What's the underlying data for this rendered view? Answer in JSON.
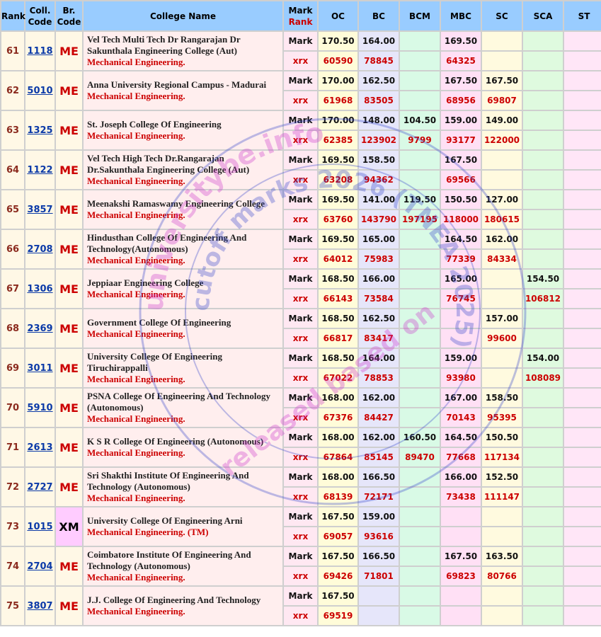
{
  "headers": {
    "rank": "Rank",
    "code_1": "Coll.",
    "code_2": "Code",
    "br_1": "Br.",
    "br_2": "Code",
    "college": "College Name",
    "mark_rank_1": "Mark",
    "mark_rank_2": "Rank",
    "oc": "OC",
    "bc": "BC",
    "bcm": "BCM",
    "mbc": "MBC",
    "sc": "SC",
    "sca": "SCA",
    "st": "ST"
  },
  "labels": {
    "mark": "Mark",
    "rank": "xrx"
  },
  "watermark": {
    "line1": "cutoff marks 2026 (TNEA 2025)",
    "line2": "universitybe.info",
    "line3": "released based on"
  },
  "colleges": [
    {
      "rank": "61",
      "code": "1118",
      "branch": "ME",
      "name": "Vel Tech Multi Tech Dr Rangarajan Dr Sakunthala Engineering College (Aut)",
      "course": "Mechanical Engineering.",
      "mark": {
        "oc": "170.50",
        "bc": "164.00",
        "bcm": "",
        "mbc": "169.50",
        "sc": "",
        "sca": "",
        "st": ""
      },
      "rank_vals": {
        "oc": "60590",
        "bc": "78845",
        "bcm": "",
        "mbc": "64325",
        "sc": "",
        "sca": "",
        "st": ""
      }
    },
    {
      "rank": "62",
      "code": "5010",
      "branch": "ME",
      "name": "Anna University Regional Campus - Madurai",
      "course": "Mechanical Engineering.",
      "mark": {
        "oc": "170.00",
        "bc": "162.50",
        "bcm": "",
        "mbc": "167.50",
        "sc": "167.50",
        "sca": "",
        "st": ""
      },
      "rank_vals": {
        "oc": "61968",
        "bc": "83505",
        "bcm": "",
        "mbc": "68956",
        "sc": "69807",
        "sca": "",
        "st": ""
      }
    },
    {
      "rank": "63",
      "code": "1325",
      "branch": "ME",
      "name": "St. Joseph College Of Engineering",
      "course": "Mechanical Engineering.",
      "mark": {
        "oc": "170.00",
        "bc": "148.00",
        "bcm": "104.50",
        "mbc": "159.00",
        "sc": "149.00",
        "sca": "",
        "st": ""
      },
      "rank_vals": {
        "oc": "62385",
        "bc": "123902",
        "bcm": "9799",
        "mbc": "93177",
        "sc": "122000",
        "sca": "",
        "st": ""
      }
    },
    {
      "rank": "64",
      "code": "1122",
      "branch": "ME",
      "name": "Vel Tech High Tech Dr.Rangarajan Dr.Sakunthala Engineering College (Aut)",
      "course": "Mechanical Engineering.",
      "mark": {
        "oc": "169.50",
        "bc": "158.50",
        "bcm": "",
        "mbc": "167.50",
        "sc": "",
        "sca": "",
        "st": ""
      },
      "rank_vals": {
        "oc": "63208",
        "bc": "94362",
        "bcm": "",
        "mbc": "69566",
        "sc": "",
        "sca": "",
        "st": ""
      }
    },
    {
      "rank": "65",
      "code": "3857",
      "branch": "ME",
      "name": "Meenakshi Ramaswamy Engineering College",
      "course": "Mechanical Engineering.",
      "mark": {
        "oc": "169.50",
        "bc": "141.00",
        "bcm": "119.50",
        "mbc": "150.50",
        "sc": "127.00",
        "sca": "",
        "st": ""
      },
      "rank_vals": {
        "oc": "63760",
        "bc": "143790",
        "bcm": "197195",
        "mbc": "118000",
        "sc": "180615",
        "sca": "",
        "st": ""
      }
    },
    {
      "rank": "66",
      "code": "2708",
      "branch": "ME",
      "name": "Hindusthan College Of Engineering And Technology(Autonomous)",
      "course": "Mechanical Engineering.",
      "mark": {
        "oc": "169.50",
        "bc": "165.00",
        "bcm": "",
        "mbc": "164.50",
        "sc": "162.00",
        "sca": "",
        "st": ""
      },
      "rank_vals": {
        "oc": "64012",
        "bc": "75983",
        "bcm": "",
        "mbc": "77339",
        "sc": "84334",
        "sca": "",
        "st": ""
      }
    },
    {
      "rank": "67",
      "code": "1306",
      "branch": "ME",
      "name": "Jeppiaar Engineering College",
      "course": "Mechanical Engineering.",
      "mark": {
        "oc": "168.50",
        "bc": "166.00",
        "bcm": "",
        "mbc": "165.00",
        "sc": "",
        "sca": "154.50",
        "st": ""
      },
      "rank_vals": {
        "oc": "66143",
        "bc": "73584",
        "bcm": "",
        "mbc": "76745",
        "sc": "",
        "sca": "106812",
        "st": ""
      }
    },
    {
      "rank": "68",
      "code": "2369",
      "branch": "ME",
      "name": "Government College Of Engineering",
      "course": "Mechanical Engineering.",
      "mark": {
        "oc": "168.50",
        "bc": "162.50",
        "bcm": "",
        "mbc": "",
        "sc": "157.00",
        "sca": "",
        "st": ""
      },
      "rank_vals": {
        "oc": "66817",
        "bc": "83417",
        "bcm": "",
        "mbc": "",
        "sc": "99600",
        "sca": "",
        "st": ""
      }
    },
    {
      "rank": "69",
      "code": "3011",
      "branch": "ME",
      "name": "University College Of Engineering Tiruchirappalli",
      "course": "Mechanical Engineering.",
      "mark": {
        "oc": "168.50",
        "bc": "164.00",
        "bcm": "",
        "mbc": "159.00",
        "sc": "",
        "sca": "154.00",
        "st": ""
      },
      "rank_vals": {
        "oc": "67022",
        "bc": "78853",
        "bcm": "",
        "mbc": "93980",
        "sc": "",
        "sca": "108089",
        "st": ""
      }
    },
    {
      "rank": "70",
      "code": "5910",
      "branch": "ME",
      "name": "PSNA College Of Engineering And Technology (Autonomous)",
      "course": "Mechanical Engineering.",
      "mark": {
        "oc": "168.00",
        "bc": "162.00",
        "bcm": "",
        "mbc": "167.00",
        "sc": "158.50",
        "sca": "",
        "st": ""
      },
      "rank_vals": {
        "oc": "67376",
        "bc": "84427",
        "bcm": "",
        "mbc": "70143",
        "sc": "95395",
        "sca": "",
        "st": ""
      }
    },
    {
      "rank": "71",
      "code": "2613",
      "branch": "ME",
      "name": "K S R College Of Engineering (Autonomous)",
      "course": "Mechanical Engineering.",
      "mark": {
        "oc": "168.00",
        "bc": "162.00",
        "bcm": "160.50",
        "mbc": "164.50",
        "sc": "150.50",
        "sca": "",
        "st": ""
      },
      "rank_vals": {
        "oc": "67864",
        "bc": "85145",
        "bcm": "89470",
        "mbc": "77668",
        "sc": "117134",
        "sca": "",
        "st": ""
      }
    },
    {
      "rank": "72",
      "code": "2727",
      "branch": "ME",
      "name": "Sri Shakthi Institute Of Engineering And Technology (Autonomous)",
      "course": "Mechanical Engineering.",
      "mark": {
        "oc": "168.00",
        "bc": "166.50",
        "bcm": "",
        "mbc": "166.00",
        "sc": "152.50",
        "sca": "",
        "st": ""
      },
      "rank_vals": {
        "oc": "68139",
        "bc": "72171",
        "bcm": "",
        "mbc": "73438",
        "sc": "111147",
        "sca": "",
        "st": ""
      }
    },
    {
      "rank": "73",
      "code": "1015",
      "branch": "XM",
      "name": "University College Of Engineering Arni",
      "course": "Mechanical Engineering. (TM)",
      "mark": {
        "oc": "167.50",
        "bc": "159.00",
        "bcm": "",
        "mbc": "",
        "sc": "",
        "sca": "",
        "st": ""
      },
      "rank_vals": {
        "oc": "69057",
        "bc": "93616",
        "bcm": "",
        "mbc": "",
        "sc": "",
        "sca": "",
        "st": ""
      }
    },
    {
      "rank": "74",
      "code": "2704",
      "branch": "ME",
      "name": "Coimbatore Institute Of Engineering And Technology (Autonomous)",
      "course": "Mechanical Engineering.",
      "mark": {
        "oc": "167.50",
        "bc": "166.50",
        "bcm": "",
        "mbc": "167.50",
        "sc": "163.50",
        "sca": "",
        "st": ""
      },
      "rank_vals": {
        "oc": "69426",
        "bc": "71801",
        "bcm": "",
        "mbc": "69823",
        "sc": "80766",
        "sca": "",
        "st": ""
      }
    },
    {
      "rank": "75",
      "code": "3807",
      "branch": "ME",
      "name": "J.J. College Of Engineering And Technology",
      "course": "Mechanical Engineering.",
      "mark": {
        "oc": "167.50",
        "bc": "",
        "bcm": "",
        "mbc": "",
        "sc": "",
        "sca": "",
        "st": ""
      },
      "rank_vals": {
        "oc": "69519",
        "bc": "",
        "bcm": "",
        "mbc": "",
        "sc": "",
        "sca": "",
        "st": ""
      }
    }
  ]
}
